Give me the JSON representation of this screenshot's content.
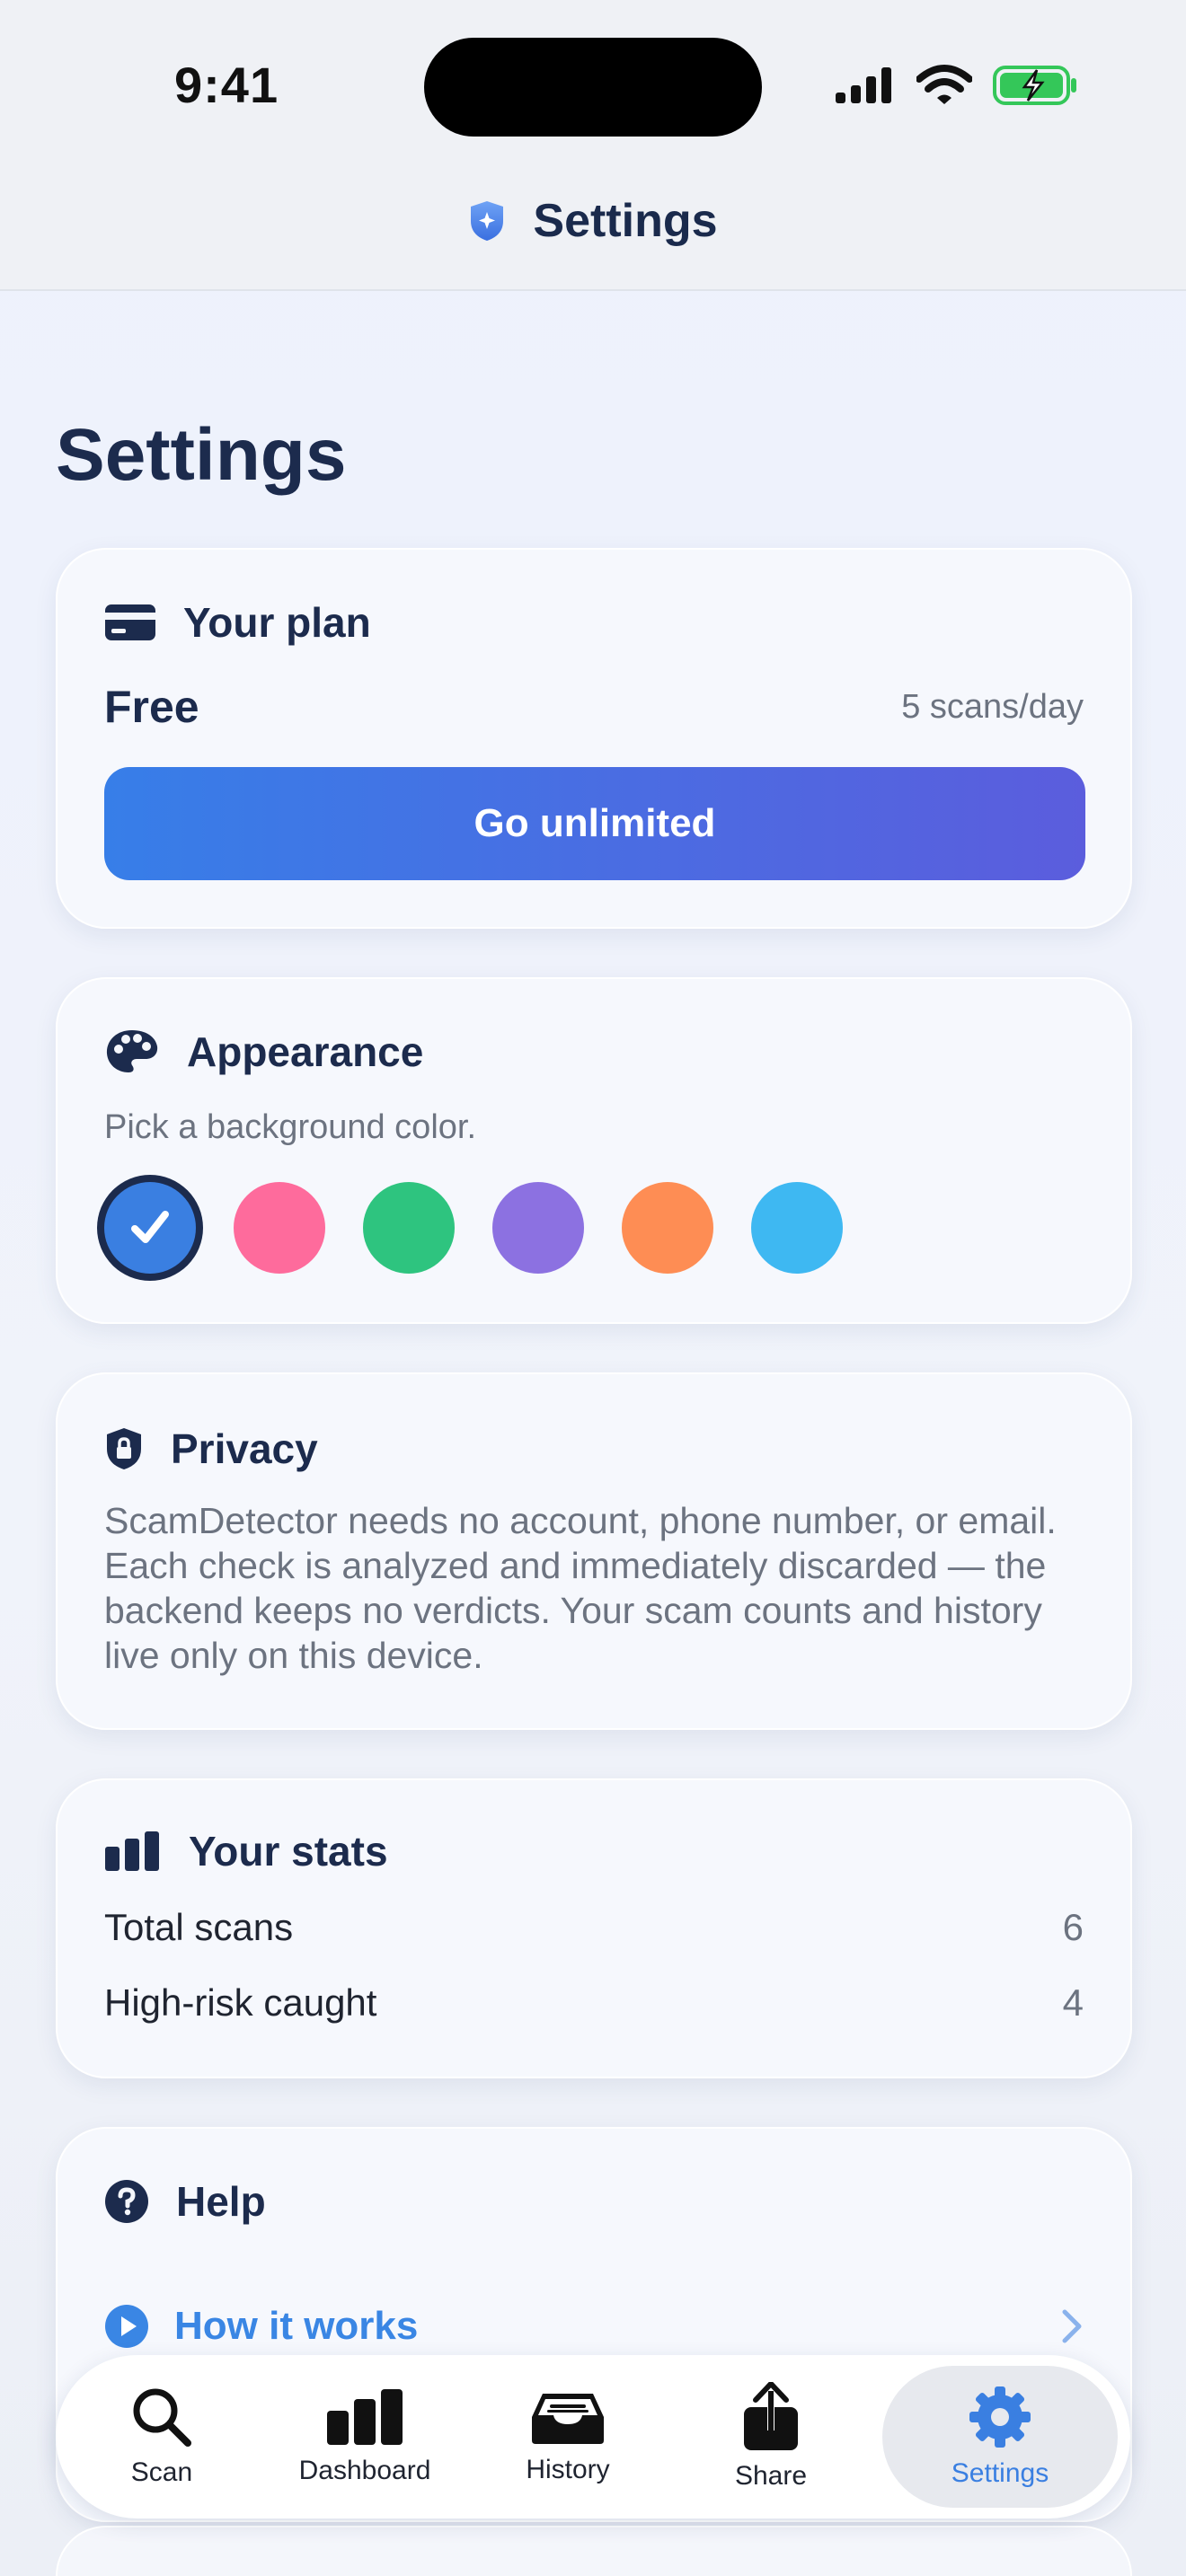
{
  "status_bar": {
    "time": "9:41"
  },
  "nav": {
    "title": "Settings",
    "logo_icon": "shield-sparkle-icon"
  },
  "page": {
    "title": "Settings"
  },
  "plan": {
    "title": "Your plan",
    "icon": "credit-card-icon",
    "name": "Free",
    "quota": "5 scans/day",
    "cta_label": "Go unlimited",
    "cta_gradient": [
      "#377ee8",
      "#5b5ddd"
    ]
  },
  "appearance": {
    "title": "Appearance",
    "icon": "palette-icon",
    "subtitle": "Pick a background color.",
    "colors": [
      "#3a7fe1",
      "#fe6b9c",
      "#2ec47f",
      "#8c71e1",
      "#fe8d54",
      "#3eb8f2"
    ],
    "selected_index": 0
  },
  "privacy": {
    "title": "Privacy",
    "icon": "shield-lock-icon",
    "body": "ScamDetector needs no account, phone number, or email. Each check is analyzed and immediately discarded — the backend keeps no verdicts. Your scam counts and history live only on this device."
  },
  "stats": {
    "title": "Your stats",
    "icon": "bar-chart-icon",
    "rows": [
      {
        "label": "Total scans",
        "value": "6"
      },
      {
        "label": "High-risk caught",
        "value": "4"
      }
    ]
  },
  "help": {
    "title": "Help",
    "icon": "question-circle-icon",
    "link_label": "How it works",
    "link_icon": "play-circle-icon"
  },
  "tabs": [
    {
      "label": "Scan",
      "icon": "magnifier-icon",
      "active": false
    },
    {
      "label": "Dashboard",
      "icon": "bar-chart-icon",
      "active": false
    },
    {
      "label": "History",
      "icon": "tray-icon",
      "active": false
    },
    {
      "label": "Share",
      "icon": "share-icon",
      "active": false
    },
    {
      "label": "Settings",
      "icon": "gear-icon",
      "active": true
    }
  ],
  "accent_color": "#3a7fe1",
  "text_color": "#1c2b4d"
}
